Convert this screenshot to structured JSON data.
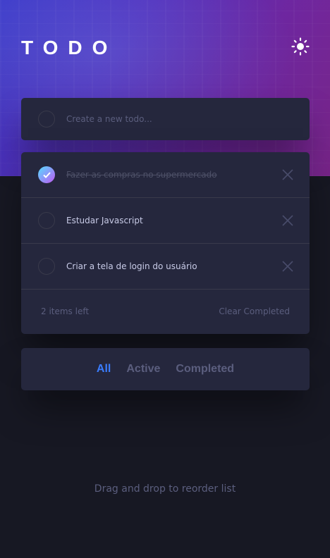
{
  "app": {
    "title": "TODO",
    "theme_icon": "sun-icon"
  },
  "new_todo": {
    "placeholder": "Create a new todo..."
  },
  "todos": [
    {
      "text": "Fazer as compras no supermercado",
      "completed": true
    },
    {
      "text": "Estudar Javascript",
      "completed": false
    },
    {
      "text": "Criar a tela de login do usuário",
      "completed": false
    }
  ],
  "footer": {
    "items_left": "2 items left",
    "clear_label": "Clear Completed"
  },
  "filters": [
    {
      "label": "All",
      "active": true
    },
    {
      "label": "Active",
      "active": false
    },
    {
      "label": "Completed",
      "active": false
    }
  ],
  "hint": "Drag and drop to reorder list",
  "colors": {
    "accent": "#3a7cfd",
    "card": "#25273d",
    "background": "#171823",
    "check_gradient_start": "#55ddff",
    "check_gradient_end": "#c058f3"
  }
}
